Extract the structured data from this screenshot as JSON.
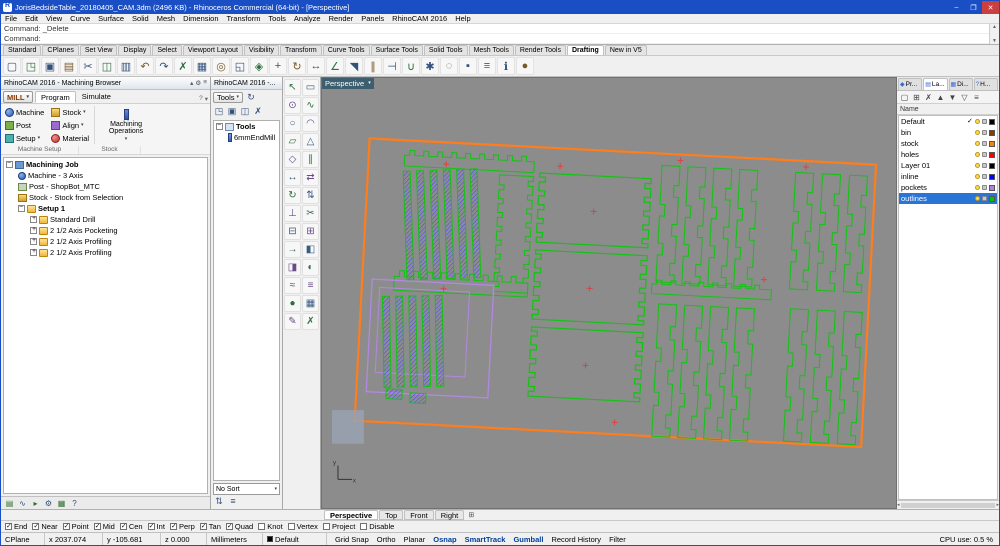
{
  "window": {
    "title": "JorisBedsideTable_20180405_CAM.3dm (2496 KB) - Rhinoceros Commercial (64-bit) - [Perspective]",
    "minimize": "–",
    "maximize": "❐",
    "close": "✕"
  },
  "menu": {
    "items": [
      "File",
      "Edit",
      "View",
      "Curve",
      "Surface",
      "Solid",
      "Mesh",
      "Dimension",
      "Transform",
      "Tools",
      "Analyze",
      "Render",
      "Panels",
      "RhinoCAM 2016",
      "Help"
    ]
  },
  "command": {
    "history": "Command: _Delete",
    "prompt": "Command:"
  },
  "toolbar_tabs": {
    "items": [
      {
        "label": "Standard"
      },
      {
        "label": "CPlanes"
      },
      {
        "label": "Set View"
      },
      {
        "label": "Display"
      },
      {
        "label": "Select"
      },
      {
        "label": "Viewport Layout"
      },
      {
        "label": "Visibility"
      },
      {
        "label": "Transform"
      },
      {
        "label": "Curve Tools"
      },
      {
        "label": "Surface Tools"
      },
      {
        "label": "Solid Tools"
      },
      {
        "label": "Mesh Tools"
      },
      {
        "label": "Render Tools"
      },
      {
        "label": "Drafting",
        "active": true
      },
      {
        "label": "New in V5"
      }
    ]
  },
  "main_toolbar": {
    "icons": [
      {
        "name": "new-file-icon",
        "glyph": "▢"
      },
      {
        "name": "open-file-icon",
        "glyph": "◳"
      },
      {
        "name": "save-file-icon",
        "glyph": "▣"
      },
      {
        "name": "print-icon",
        "glyph": "▤"
      },
      {
        "name": "cut-icon",
        "glyph": "✂"
      },
      {
        "name": "copy-icon",
        "glyph": "◫"
      },
      {
        "name": "paste-icon",
        "glyph": "▥"
      },
      {
        "name": "undo-icon",
        "glyph": "↶"
      },
      {
        "name": "redo-icon",
        "glyph": "↷"
      },
      {
        "name": "delete-icon",
        "glyph": "✗"
      },
      {
        "name": "select-all-icon",
        "glyph": "▦"
      },
      {
        "name": "zoom-dynamic-icon",
        "glyph": "◎"
      },
      {
        "name": "zoom-window-icon",
        "glyph": "◱"
      },
      {
        "name": "zoom-extents-icon",
        "glyph": "◈"
      },
      {
        "name": "pan-view-icon",
        "glyph": "+"
      },
      {
        "name": "rotate-view-icon",
        "glyph": "↻"
      },
      {
        "name": "move-icon",
        "glyph": "↔"
      },
      {
        "name": "rotate-icon",
        "glyph": "∠"
      },
      {
        "name": "scale-icon",
        "glyph": "◥"
      },
      {
        "name": "mirror-icon",
        "glyph": "∥"
      },
      {
        "name": "trim-icon",
        "glyph": "⊣"
      },
      {
        "name": "join-icon",
        "glyph": "∪"
      },
      {
        "name": "explode-icon",
        "glyph": "✱"
      },
      {
        "name": "hide-object-icon",
        "glyph": "◌"
      },
      {
        "name": "lock-object-icon",
        "glyph": "▪"
      },
      {
        "name": "layer-manager-icon",
        "glyph": "≡"
      },
      {
        "name": "properties-icon",
        "glyph": "ℹ"
      },
      {
        "name": "render-icon",
        "glyph": "●"
      }
    ]
  },
  "side_toolbar": {
    "icons": [
      {
        "name": "select-tool-icon",
        "glyph": "↖"
      },
      {
        "name": "selection-window-icon",
        "glyph": "▭"
      },
      {
        "name": "point-tool-icon",
        "glyph": "⊙"
      },
      {
        "name": "curve-tool-icon",
        "glyph": "∿"
      },
      {
        "name": "circle-tool-icon",
        "glyph": "○"
      },
      {
        "name": "arc-tool-icon",
        "glyph": "◠"
      },
      {
        "name": "rectangle-tool-icon",
        "glyph": "▱"
      },
      {
        "name": "polygon-tool-icon",
        "glyph": "△"
      },
      {
        "name": "ellipse-tool-icon",
        "glyph": "◇"
      },
      {
        "name": "offset-tool-icon",
        "glyph": "∥"
      },
      {
        "name": "move-tool-icon",
        "glyph": "↔"
      },
      {
        "name": "copy-tool-icon",
        "glyph": "⇄"
      },
      {
        "name": "rotate-tool-icon",
        "glyph": "↻"
      },
      {
        "name": "scale-tool-icon",
        "glyph": "⇅"
      },
      {
        "name": "mirror-tool-icon",
        "glyph": "⊥"
      },
      {
        "name": "trim-tool-icon",
        "glyph": "✂"
      },
      {
        "name": "split-tool-icon",
        "glyph": "⊟"
      },
      {
        "name": "join-tool-icon",
        "glyph": "⊞"
      },
      {
        "name": "extend-tool-icon",
        "glyph": "→"
      },
      {
        "name": "surface-tool-icon",
        "glyph": "◧"
      },
      {
        "name": "extrude-tool-icon",
        "glyph": "◨"
      },
      {
        "name": "revolve-tool-icon",
        "glyph": "◐"
      },
      {
        "name": "sweep-tool-icon",
        "glyph": "≈"
      },
      {
        "name": "loft-tool-icon",
        "glyph": "≡"
      },
      {
        "name": "boolean-tool-icon",
        "glyph": "●"
      },
      {
        "name": "mesh-tool-icon",
        "glyph": "▦"
      },
      {
        "name": "annotate-tool-icon",
        "glyph": "✎"
      },
      {
        "name": "delete-tool-icon",
        "glyph": "✗"
      }
    ]
  },
  "machining_browser": {
    "title": "RhinoCAM 2016 - Machining Browser",
    "mill_button": "MILL",
    "tabs": [
      {
        "label": "Program",
        "active": true
      },
      {
        "label": "Simulate"
      }
    ],
    "ribbon": {
      "machine": "Machine",
      "post": "Post",
      "setup": "Setup",
      "stock": "Stock",
      "align": "Align",
      "material": "Material",
      "machining_operations_line1": "Machining",
      "machining_operations_line2": "Operations",
      "group_machine_setup": "Machine Setup",
      "group_stock": "Stock"
    },
    "tree": {
      "root": "Machining Job",
      "machine": "Machine - 3 Axis",
      "post": "Post - ShopBot_MTC",
      "stock": "Stock - Stock from Selection",
      "setup": "Setup 1",
      "operations": [
        "Standard Drill",
        "2 1/2 Axis Pocketing",
        "2 1/2 Axis Profiling",
        "2 1/2 Axis Profiling"
      ]
    },
    "bottom_icons": [
      {
        "name": "machining-objects-icon",
        "glyph": "▤"
      },
      {
        "name": "toolpath-view-icon",
        "glyph": "∿"
      },
      {
        "name": "simulate-view-icon",
        "glyph": "▸"
      },
      {
        "name": "machine-setup-icon",
        "glyph": "⚙"
      },
      {
        "name": "post-output-icon",
        "glyph": "▦"
      },
      {
        "name": "help-icon",
        "glyph": "?"
      }
    ]
  },
  "tools_panel": {
    "title": "RhinoCAM 2016 -...",
    "tools_button": "Tools",
    "refresh_icon": {
      "name": "refresh-tools-icon",
      "glyph": "↻"
    },
    "icons": [
      {
        "name": "open-tool-library-icon",
        "glyph": "◳"
      },
      {
        "name": "save-tool-library-icon",
        "glyph": "▣"
      },
      {
        "name": "duplicate-tool-icon",
        "glyph": "◫"
      },
      {
        "name": "delete-tool-icon",
        "glyph": "✗"
      }
    ],
    "tree_root": "Tools",
    "tool_name": "6mmEndMill",
    "sort_label": "No Sort",
    "sort_icons": [
      {
        "name": "sort-ascending-icon",
        "glyph": "⇅"
      },
      {
        "name": "list-view-icon",
        "glyph": "≡"
      }
    ]
  },
  "viewport": {
    "label": "Perspective",
    "axis_x": "x",
    "axis_y": "y",
    "new_tab_glyph": "⊞",
    "tabs": [
      {
        "label": "Perspective",
        "active": true
      },
      {
        "label": "Top"
      },
      {
        "label": "Front"
      },
      {
        "label": "Right"
      }
    ]
  },
  "layers_panel": {
    "tabs": [
      {
        "label": "Pr...",
        "icon": "◆"
      },
      {
        "label": "La...",
        "icon": "▤",
        "active": true
      },
      {
        "label": "Di...",
        "icon": "▦"
      },
      {
        "label": "H...",
        "icon": "?"
      }
    ],
    "toolbar": [
      {
        "name": "new-layer-icon",
        "glyph": "▢"
      },
      {
        "name": "new-sublayer-icon",
        "glyph": "⊞"
      },
      {
        "name": "delete-layer-icon",
        "glyph": "✗"
      },
      {
        "name": "move-up-icon",
        "glyph": "▲"
      },
      {
        "name": "move-down-icon",
        "glyph": "▼"
      },
      {
        "name": "filter-layers-icon",
        "glyph": "▽"
      },
      {
        "name": "layer-tools-icon",
        "glyph": "≡"
      }
    ],
    "name_header": "Name",
    "layers": [
      {
        "name": "Default",
        "color": "#000000",
        "current": true
      },
      {
        "name": "bin",
        "color": "#7f3f00"
      },
      {
        "name": "stock",
        "color": "#ff7f00"
      },
      {
        "name": "holes",
        "color": "#ff0000"
      },
      {
        "name": "Layer 01",
        "color": "#000000"
      },
      {
        "name": "inline",
        "color": "#0000ff"
      },
      {
        "name": "pockets",
        "color": "#b380e6"
      },
      {
        "name": "outlines",
        "color": "#00c800",
        "selected": true
      }
    ]
  },
  "osnap": {
    "items": [
      {
        "label": "End",
        "checked": true
      },
      {
        "label": "Near",
        "checked": true
      },
      {
        "label": "Point",
        "checked": true
      },
      {
        "label": "Mid",
        "checked": true
      },
      {
        "label": "Cen",
        "checked": true
      },
      {
        "label": "Int",
        "checked": true
      },
      {
        "label": "Perp",
        "checked": true
      },
      {
        "label": "Tan",
        "checked": true
      },
      {
        "label": "Quad",
        "checked": true
      },
      {
        "label": "Knot"
      },
      {
        "label": "Vertex"
      },
      {
        "label": "Project"
      },
      {
        "label": "Disable"
      }
    ]
  },
  "status_bar": {
    "cplane": "CPlane",
    "x": "x 2037.074",
    "y": "y -105.681",
    "z": "z 0.000",
    "units": "Millimeters",
    "layer": "Default",
    "toggles": [
      {
        "label": "Grid Snap"
      },
      {
        "label": "Ortho"
      },
      {
        "label": "Planar"
      },
      {
        "label": "Osnap",
        "active": true
      },
      {
        "label": "SmartTrack",
        "active": true
      },
      {
        "label": "Gumball",
        "active": true
      },
      {
        "label": "Record History"
      },
      {
        "label": "Filter"
      }
    ],
    "cpu": "CPU use: 0.5 %"
  },
  "colors": {
    "sheet": "#ff7d1a",
    "outlines": "#12c312",
    "pocket_hatch": "#4646ff",
    "pockets": "#b388e0",
    "viewport_bg": "#8c8c8c",
    "selection": "#2a74d6"
  }
}
